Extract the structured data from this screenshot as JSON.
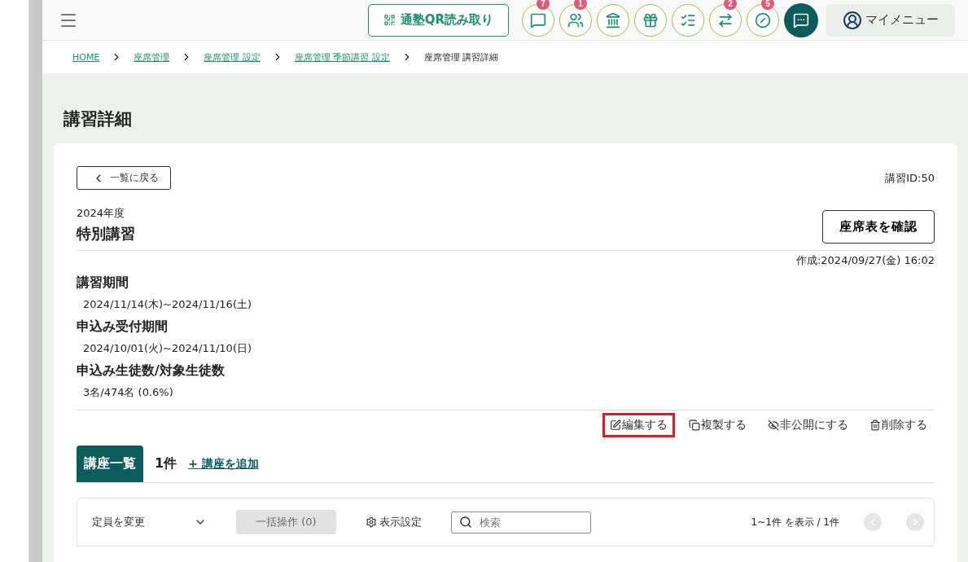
{
  "header": {
    "qr_button": "通塾QR読み取り",
    "icon_buttons": [
      {
        "kind": "message",
        "badge": "7"
      },
      {
        "kind": "people",
        "badge": "1"
      },
      {
        "kind": "building"
      },
      {
        "kind": "gift"
      },
      {
        "kind": "checklist"
      },
      {
        "kind": "merge",
        "badge": "2"
      },
      {
        "kind": "blocked",
        "badge": "5"
      }
    ],
    "chat_button": {
      "kind": "chat"
    },
    "my_menu": "マイメニュー"
  },
  "breadcrumbs": [
    {
      "label": "HOME",
      "link": true
    },
    {
      "label": "座席管理",
      "link": true
    },
    {
      "label": "座席管理 設定",
      "link": true
    },
    {
      "label": "座席管理 季節講習 設定",
      "link": true
    },
    {
      "label": "座席管理 講習詳細",
      "link": false
    }
  ],
  "page_title": "講習詳細",
  "detail": {
    "back_button": "一覧に戻る",
    "course_id": "講習ID:50",
    "year": "2024年度",
    "name": "特別講習",
    "seat_button": "座席表を確認",
    "created": "作成:2024/09/27(金) 16:02",
    "fields": [
      {
        "label": "講習期間",
        "value": "2024/11/14(木)~2024/11/16(土)"
      },
      {
        "label": "申込み受付期間",
        "value": "2024/10/01(火)~2024/11/10(日)"
      },
      {
        "label": "申込み生徒数/対象生徒数",
        "value": "3名/474名 (0.6%)"
      }
    ],
    "actions": [
      {
        "kind": "edit",
        "label": "編集する",
        "highlighted": true
      },
      {
        "kind": "copy",
        "label": "複製する",
        "highlighted": false
      },
      {
        "kind": "hide",
        "label": "非公開にする",
        "highlighted": false
      },
      {
        "kind": "delete",
        "label": "削除する",
        "highlighted": false
      }
    ]
  },
  "tabs": [
    {
      "label": "講座一覧",
      "selected": true
    }
  ],
  "count": "1件",
  "add_link": "+ 講座を追加",
  "toolbar": {
    "capacity_select": "定員を変更",
    "bulk_button": "一括操作 (0)",
    "display_settings": "表示設定",
    "search": {
      "placeholder": "検索"
    },
    "range": "1~1件 を表示 / 1件"
  }
}
